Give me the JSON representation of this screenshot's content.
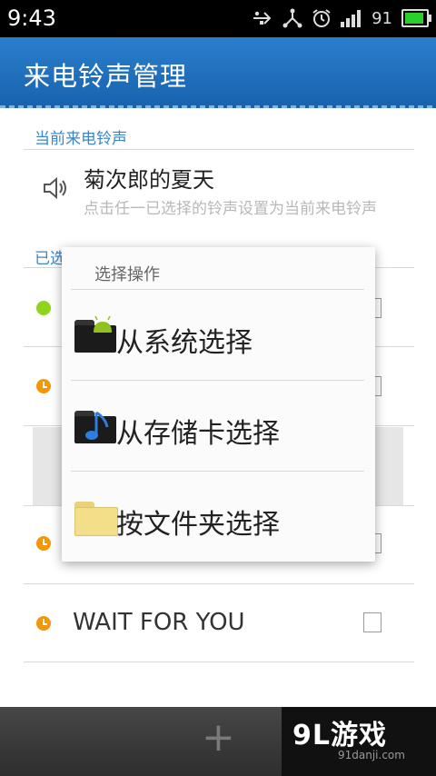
{
  "status_bar": {
    "time": "9:43",
    "battery_level": "91",
    "icons": [
      "usb-icon",
      "network-icon",
      "alarm-icon",
      "signal-icon",
      "battery-icon"
    ]
  },
  "app_bar": {
    "title": "来电铃声管理"
  },
  "current_section": {
    "label": "当前来电铃声",
    "ringtone_name": "菊次郎的夏天",
    "hint": "点击任一已选择的铃声设置为当前来电铃声"
  },
  "selected_section": {
    "label": "已选择的铃声"
  },
  "list_rows": [
    {
      "text": "",
      "icon": "green-dot-icon"
    },
    {
      "text": "",
      "icon": "clock-icon"
    },
    {
      "text": "",
      "icon": ""
    },
    {
      "text": "",
      "icon": "clock-icon"
    },
    {
      "text": "WAIT FOR YOU",
      "icon": "clock-icon"
    }
  ],
  "dialog": {
    "title": "选择操作",
    "options": [
      {
        "label": "从系统选择",
        "icon": "android-folder-icon"
      },
      {
        "label": "从存储卡选择",
        "icon": "music-folder-icon"
      },
      {
        "label": "按文件夹选择",
        "icon": "yellow-folder-icon"
      }
    ]
  },
  "bottom_bar": {
    "add_symbol": "+",
    "watermark": "9L游戏",
    "watermark_sub": "91danji.com"
  },
  "colors": {
    "accent": "#1f6fbb",
    "section_label": "#3a86c8",
    "battery": "#27d02b"
  }
}
